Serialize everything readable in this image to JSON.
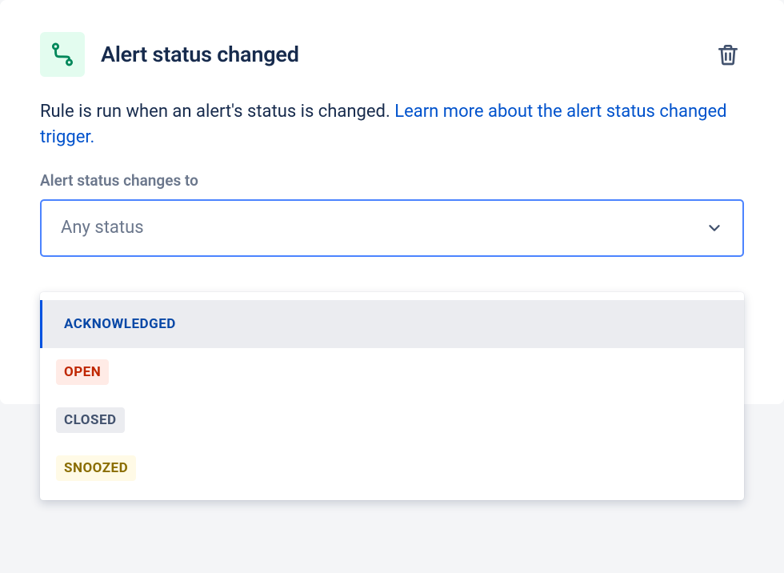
{
  "header": {
    "title": "Alert status changed"
  },
  "description": {
    "text": "Rule is run when an alert's status is changed. ",
    "link_text": "Learn more about the alert status changed trigger."
  },
  "field": {
    "label": "Alert status changes to",
    "placeholder": "Any status"
  },
  "options": {
    "acknowledged": "ACKNOWLEDGED",
    "open": "OPEN",
    "closed": "CLOSED",
    "snoozed": "SNOOZED"
  }
}
